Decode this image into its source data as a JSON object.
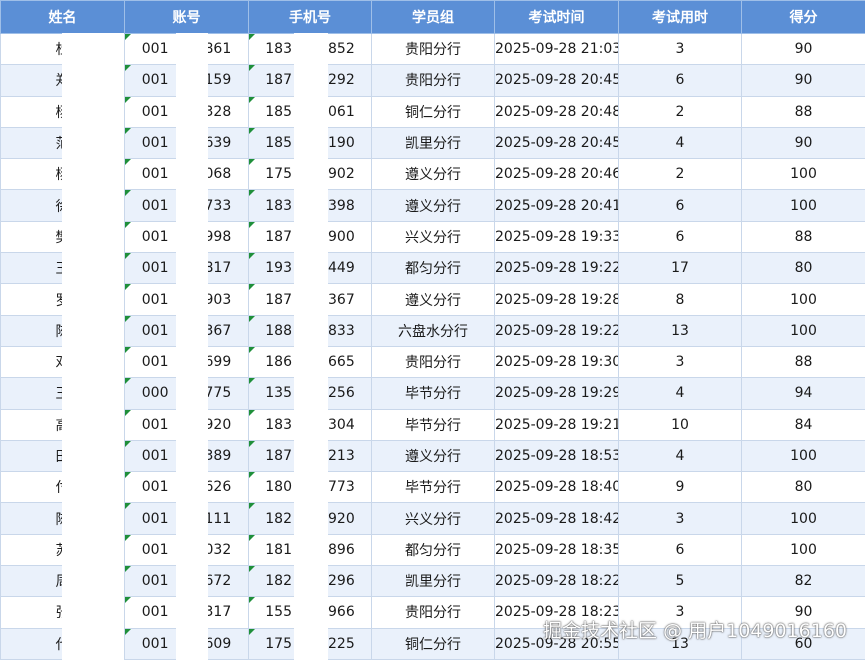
{
  "table": {
    "headers": [
      "姓名",
      "账号",
      "手机号",
      "学员组",
      "考试时间",
      "考试用时",
      "得分"
    ],
    "rows": [
      {
        "name": "杜",
        "account": "001",
        "phone": "183",
        "account_tail": "861",
        "phone_tail": "852",
        "group": "贵阳分行",
        "time": "2025-09-28 21:03",
        "duration": "3",
        "score": "90"
      },
      {
        "name": "郑",
        "account": "001",
        "phone": "187",
        "account_tail": "159",
        "phone_tail": "292",
        "group": "贵阳分行",
        "time": "2025-09-28 20:45",
        "duration": "6",
        "score": "90"
      },
      {
        "name": "杨",
        "account": "001",
        "phone": "185",
        "account_tail": "328",
        "phone_tail": "061",
        "group": "铜仁分行",
        "time": "2025-09-28 20:48",
        "duration": "2",
        "score": "88"
      },
      {
        "name": "范",
        "account": "001",
        "phone": "185",
        "account_tail": "639",
        "phone_tail": "190",
        "group": "凯里分行",
        "time": "2025-09-28 20:45",
        "duration": "4",
        "score": "90"
      },
      {
        "name": "杨",
        "account": "001",
        "phone": "175",
        "account_tail": "068",
        "phone_tail": "902",
        "group": "遵义分行",
        "time": "2025-09-28 20:46",
        "duration": "2",
        "score": "100"
      },
      {
        "name": "徐",
        "account": "001",
        "phone": "183",
        "account_tail": "733",
        "phone_tail": "398",
        "group": "遵义分行",
        "time": "2025-09-28 20:41",
        "duration": "6",
        "score": "100"
      },
      {
        "name": "樊",
        "account": "001",
        "phone": "187",
        "account_tail": "998",
        "phone_tail": "900",
        "group": "兴义分行",
        "time": "2025-09-28 19:33",
        "duration": "6",
        "score": "88"
      },
      {
        "name": "王",
        "account": "001",
        "phone": "193",
        "account_tail": "817",
        "phone_tail": "449",
        "group": "都匀分行",
        "time": "2025-09-28 19:22",
        "duration": "17",
        "score": "80"
      },
      {
        "name": "罗",
        "account": "001",
        "phone": "187",
        "account_tail": "903",
        "phone_tail": "367",
        "group": "遵义分行",
        "time": "2025-09-28 19:28",
        "duration": "8",
        "score": "100"
      },
      {
        "name": "陈",
        "account": "001",
        "phone": "188",
        "account_tail": "367",
        "phone_tail": "833",
        "group": "六盘水分行",
        "time": "2025-09-28 19:22",
        "duration": "13",
        "score": "100"
      },
      {
        "name": "邓",
        "account": "001",
        "phone": "186",
        "account_tail": "699",
        "phone_tail": "665",
        "group": "贵阳分行",
        "time": "2025-09-28 19:30",
        "duration": "3",
        "score": "88"
      },
      {
        "name": "王",
        "account": "000",
        "phone": "135",
        "account_tail": "775",
        "phone_tail": "256",
        "group": "毕节分行",
        "time": "2025-09-28 19:29",
        "duration": "4",
        "score": "94"
      },
      {
        "name": "高",
        "account": "001",
        "phone": "183",
        "account_tail": "920",
        "phone_tail": "304",
        "group": "毕节分行",
        "time": "2025-09-28 19:21",
        "duration": "10",
        "score": "84"
      },
      {
        "name": "田",
        "account": "001",
        "phone": "187",
        "account_tail": "389",
        "phone_tail": "213",
        "group": "遵义分行",
        "time": "2025-09-28 18:53",
        "duration": "4",
        "score": "100"
      },
      {
        "name": "付",
        "account": "001",
        "phone": "180",
        "account_tail": "626",
        "phone_tail": "773",
        "group": "毕节分行",
        "time": "2025-09-28 18:40",
        "duration": "9",
        "score": "80"
      },
      {
        "name": "陈",
        "account": "001",
        "phone": "182",
        "account_tail": "111",
        "phone_tail": "920",
        "group": "兴义分行",
        "time": "2025-09-28 18:42",
        "duration": "3",
        "score": "100"
      },
      {
        "name": "苏",
        "account": "001",
        "phone": "181",
        "account_tail": "032",
        "phone_tail": "896",
        "group": "都匀分行",
        "time": "2025-09-28 18:35",
        "duration": "6",
        "score": "100"
      },
      {
        "name": "周",
        "account": "001",
        "phone": "182",
        "account_tail": "672",
        "phone_tail": "296",
        "group": "凯里分行",
        "time": "2025-09-28 18:22",
        "duration": "5",
        "score": "82"
      },
      {
        "name": "张",
        "account": "001",
        "phone": "155",
        "account_tail": "317",
        "phone_tail": "966",
        "group": "贵阳分行",
        "time": "2025-09-28 18:23",
        "duration": "3",
        "score": "90"
      },
      {
        "name": "代",
        "account": "001",
        "phone": "175",
        "account_tail": "609",
        "phone_tail": "225",
        "group": "铜仁分行",
        "time": "2025-09-28 20:55",
        "duration": "13",
        "score": "60"
      }
    ]
  },
  "watermark": "掘金技术社区 @ 用户1049016160",
  "colors": {
    "header_bg": "#5b8fd6",
    "row_alt_bg": "#eaf1fb",
    "flag": "#1f8f3a"
  }
}
